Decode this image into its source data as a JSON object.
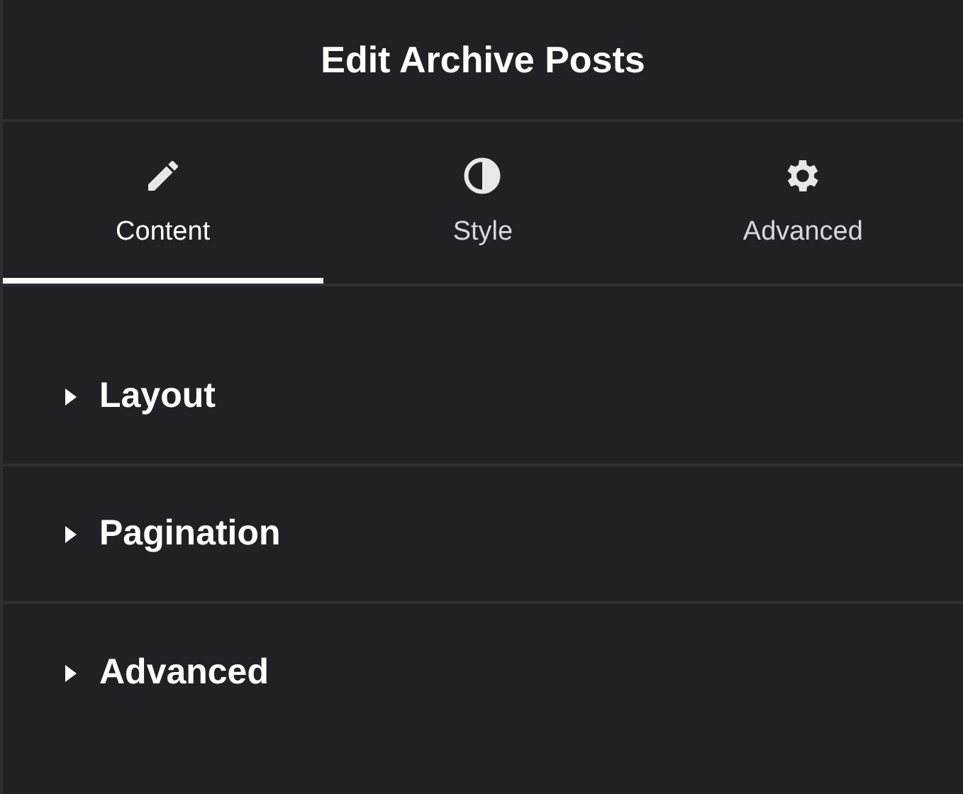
{
  "header": {
    "title": "Edit Archive Posts"
  },
  "tabs": [
    {
      "label": "Content",
      "selected": true
    },
    {
      "label": "Style",
      "selected": false
    },
    {
      "label": "Advanced",
      "selected": false
    }
  ],
  "sections": [
    {
      "title": "Layout",
      "expanded": false
    },
    {
      "title": "Pagination",
      "expanded": false
    },
    {
      "title": "Advanced",
      "expanded": false
    }
  ]
}
